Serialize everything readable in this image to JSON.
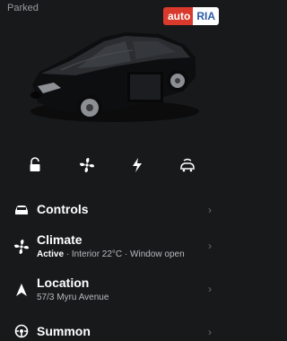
{
  "status": "Parked",
  "watermark": {
    "part1": "auto",
    "part2": "RIA"
  },
  "quick_actions": [
    {
      "name": "lock",
      "icon": "unlock-icon"
    },
    {
      "name": "climate",
      "icon": "fan-icon"
    },
    {
      "name": "charge",
      "icon": "bolt-icon"
    },
    {
      "name": "summon",
      "icon": "car-summon-icon"
    }
  ],
  "menu": {
    "controls": {
      "title": "Controls",
      "icon": "car-icon"
    },
    "climate": {
      "title": "Climate",
      "status": "Active",
      "detail": " · Interior 22°C · Window open",
      "icon": "fan-icon"
    },
    "location": {
      "title": "Location",
      "address": "57/3 Myru Avenue",
      "icon": "navigation-arrow-icon"
    },
    "summon": {
      "title": "Summon",
      "icon": "steering-wheel-icon"
    }
  },
  "colors": {
    "background": "#18191b",
    "text": "#ffffff",
    "muted": "#b8babd",
    "brand_red": "#d93a2b",
    "brand_blue": "#2b5aa8"
  }
}
